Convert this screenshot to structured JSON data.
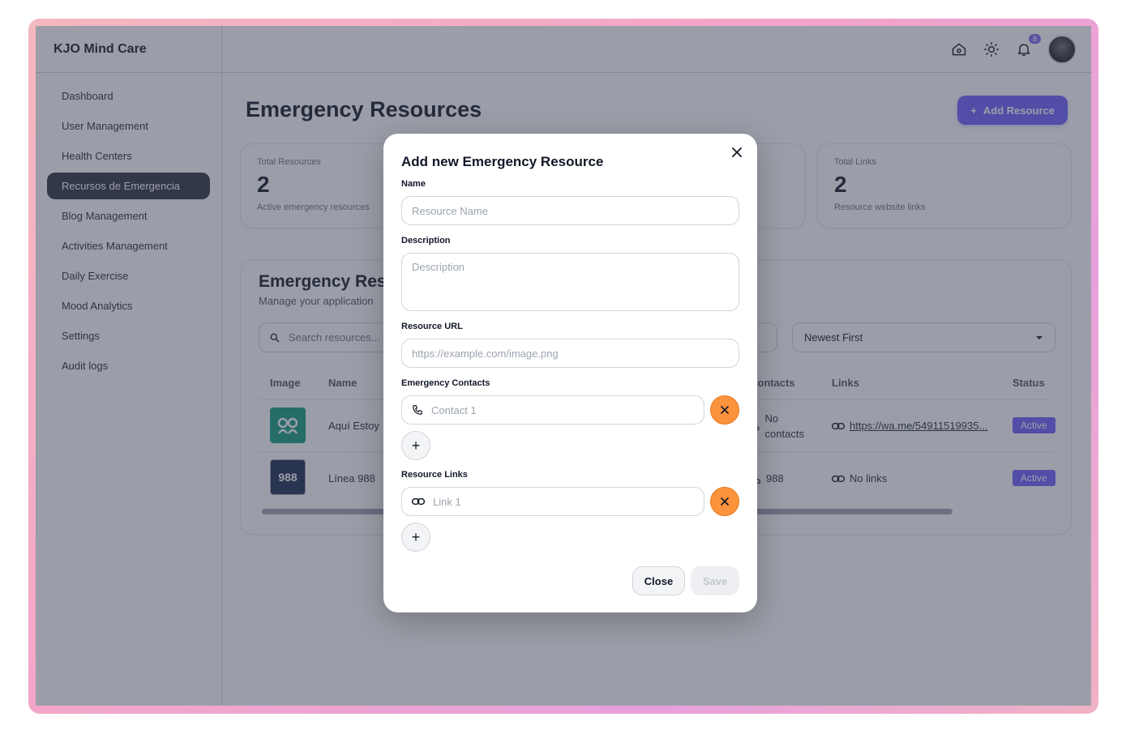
{
  "app": {
    "brand": "KJO Mind Care"
  },
  "sidebar": {
    "items": [
      {
        "label": "Dashboard",
        "active": false
      },
      {
        "label": "User Management",
        "active": false
      },
      {
        "label": "Health Centers",
        "active": false
      },
      {
        "label": "Recursos de Emergencia",
        "active": true
      },
      {
        "label": "Blog Management",
        "active": false
      },
      {
        "label": "Activities Management",
        "active": false
      },
      {
        "label": "Daily Exercise",
        "active": false
      },
      {
        "label": "Mood Analytics",
        "active": false
      },
      {
        "label": "Settings",
        "active": false
      },
      {
        "label": "Audit logs",
        "active": false
      }
    ]
  },
  "topbar": {
    "notification_count": "8"
  },
  "main": {
    "title": "Emergency Resources",
    "add_button": "Add Resource",
    "stats": [
      {
        "label": "Total Resources",
        "value": "2",
        "sub": "Active emergency resources"
      },
      {
        "label": "Total Links",
        "value": "2",
        "sub": "Resource website links"
      }
    ],
    "panel": {
      "title": "Emergency Res",
      "subtitle": "Manage your application",
      "search_placeholder": "Search resources...",
      "sort_value": "Newest First",
      "columns": {
        "image": "Image",
        "name": "Name",
        "contacts": "Contacts",
        "links": "Links",
        "status": "Status"
      },
      "rows": [
        {
          "name": "Aquí Estoy",
          "contacts": "No contacts",
          "links": "https://wa.me/54911519935...",
          "status": "Active"
        },
        {
          "name": "Línea 988",
          "contacts": "988",
          "links": "No links",
          "status": "Active"
        }
      ],
      "thumb_988": "988"
    }
  },
  "modal": {
    "title": "Add new Emergency Resource",
    "name_label": "Name",
    "name_placeholder": "Resource Name",
    "description_label": "Description",
    "description_placeholder": "Description",
    "url_label": "Resource URL",
    "url_placeholder": "https://example.com/image.png",
    "contacts_label": "Emergency Contacts",
    "contact_placeholder": "Contact 1",
    "links_label": "Resource Links",
    "link_placeholder": "Link 1",
    "close_button": "Close",
    "save_button": "Save"
  },
  "colors": {
    "accent": "#6d5dfc",
    "remove": "#fb923c",
    "sidebar_active": "#2f3340"
  }
}
